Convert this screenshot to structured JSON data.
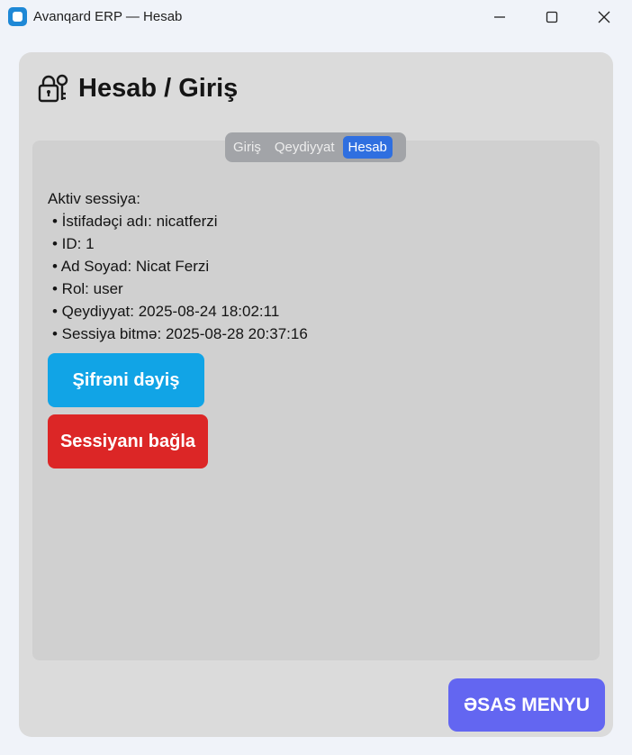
{
  "window": {
    "title": "Avanqard ERP — Hesab",
    "app_icon": "app-icon",
    "controls": [
      "minimize-icon",
      "maximize-icon",
      "close-icon"
    ]
  },
  "header": {
    "icon": "lock-key-icon",
    "title": "Hesab / Giriş"
  },
  "tabs": [
    {
      "label": "Giriş",
      "active": false
    },
    {
      "label": "Qeydiyyat",
      "active": false
    },
    {
      "label": "Hesab",
      "active": true
    }
  ],
  "session": {
    "heading": "Aktiv sessiya:",
    "lines": [
      "• İstifadəçi adı: nicatferzi",
      "• ID: 1",
      "• Ad Soyad: Nicat Ferzi",
      "• Rol: user",
      "• Qeydiyyat: 2025-08-24 18:02:11",
      "• Sessiya bitmə: 2025-08-28 20:37:16"
    ]
  },
  "buttons": {
    "change_password": "Şifrəni dəyiş",
    "logout": "Sessiyanı bağla",
    "main_menu": "ƏSAS MENYU"
  },
  "colors": {
    "active_tab": "#2f6fe0",
    "change_password": "#11a4e6",
    "logout": "#dc2626",
    "main_menu": "#6366f1"
  }
}
